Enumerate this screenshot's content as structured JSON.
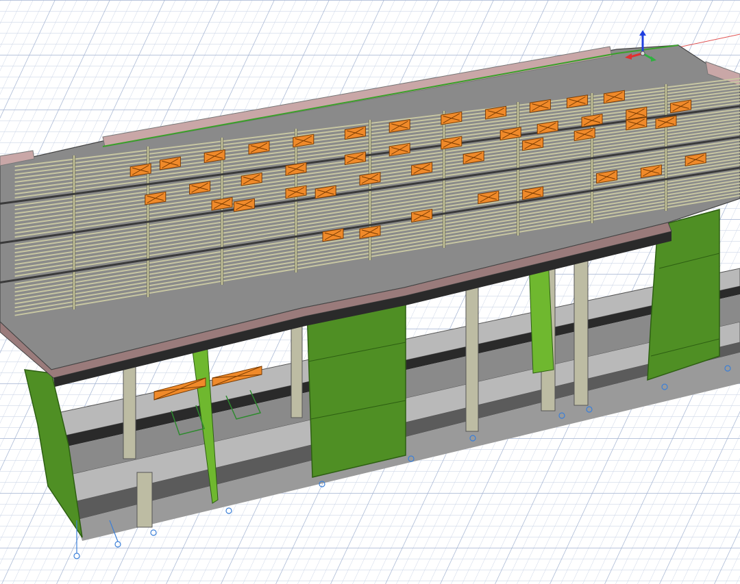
{
  "viewport": {
    "background": "#ffffff",
    "grid_minor_color": "#c9d3e6",
    "grid_major_color": "#9fb0d0",
    "origin_axis_color": "#e05050"
  },
  "model": {
    "floors_visible": 3,
    "colors": {
      "slab_top": "#8a8a8a",
      "slab_edge": "#b9b9b9",
      "slab_underside": "#5b5b5b",
      "rib": "#c8c7a2",
      "rib_dark": "#7f7e5e",
      "wall_green": "#4f8f24",
      "wall_green_light": "#6fb82f",
      "wall_outline": "#2d5e12",
      "column": "#bdbca3",
      "column_shadow": "#8a896f",
      "beam_dark": "#2a2a2a",
      "parapet": "#c9a7a7",
      "opening_fill": "#f08a2a",
      "opening_outline": "#7a3b00",
      "support_symbol": "#3a7fd8"
    }
  },
  "gizmo": {
    "icon": "xyz-axis-gizmo-icon",
    "x_color": "#e03030",
    "y_color": "#30b040",
    "z_color": "#2040e0"
  }
}
